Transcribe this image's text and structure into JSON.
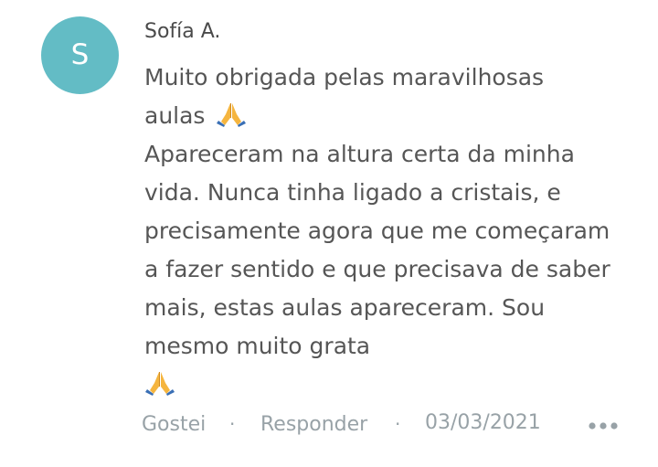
{
  "comment": {
    "avatar_letter": "S",
    "avatar_color": "#63bcc5",
    "author": "Sofía A.",
    "body": {
      "line1": "Muito obrigada pelas maravilhosas",
      "line2": "aulas",
      "paragraph2": "Apareceram na altura certa da minha vida. Nunca tinha ligado a cristais, e precisamente agora que me começaram a fazer sentido e que precisava de saber mais, estas aulas apareceram. Sou mesmo muito grata"
    },
    "actions": {
      "like_label": "Gostei",
      "separator": "·",
      "reply_label": "Responder",
      "date": "03/03/2021",
      "more_icon": "more-options-icon"
    }
  }
}
